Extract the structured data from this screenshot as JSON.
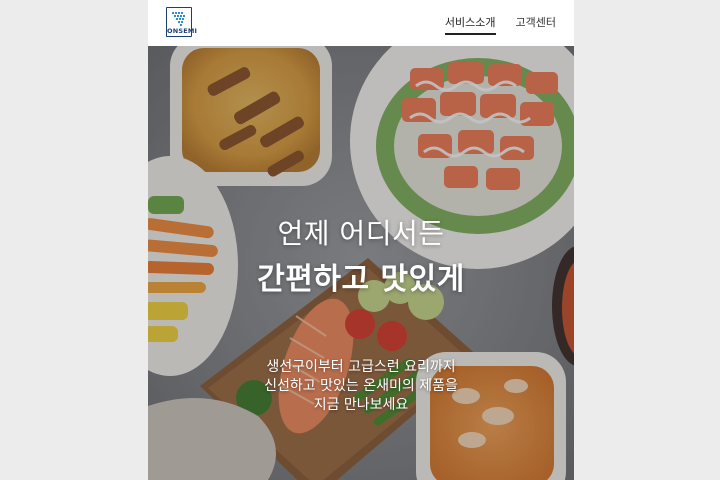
{
  "header": {
    "logo_text": "ONSEMI",
    "nav": [
      {
        "label": "서비스소개",
        "active": true
      },
      {
        "label": "고객센터",
        "active": false
      }
    ]
  },
  "hero": {
    "headline_line1": "언제 어디서든",
    "headline_line2": "간편하고 맛있게",
    "subtext_line1": "생선구이부터 고급스런 요리까지",
    "subtext_line2": "신선하고 맛있는 온새미의 제품을",
    "subtext_line3": "지금 만나보세요"
  },
  "colors": {
    "brand": "#1a3f73",
    "page_background": "#ececec",
    "header_background": "#ffffff",
    "hero_text": "#ffffff"
  }
}
